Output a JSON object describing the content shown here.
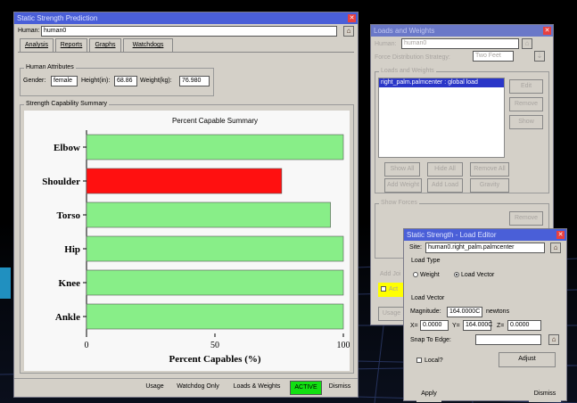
{
  "main": {
    "title": "Static Strength Prediction",
    "human_label": "Human:",
    "human_value": "human0",
    "tabs": [
      "Analysis",
      "Reports",
      "Graphs",
      "Watchdogs"
    ],
    "attributes": {
      "title": "Human Attributes",
      "gender_label": "Gender:",
      "gender_value": "female",
      "height_label": "Height(in):",
      "height_value": "68.86",
      "weight_label": "Weight(kg):",
      "weight_value": "76.980"
    },
    "summary_title": "Strength Capability Summary",
    "bottom_buttons": [
      "Usage",
      "Watchdog Only",
      "Loads & Weights",
      "ACTIVE",
      "Dismiss"
    ]
  },
  "chart_data": {
    "type": "bar",
    "orientation": "horizontal",
    "title": "Percent Capable Summary",
    "xlabel": "Percent Capables (%)",
    "xlim": [
      0,
      100
    ],
    "xticks": [
      "0",
      "50",
      "100"
    ],
    "categories": [
      "Elbow",
      "Shoulder",
      "Torso",
      "Hip",
      "Knee",
      "Ankle"
    ],
    "values": [
      100,
      76,
      95,
      100,
      100,
      100
    ],
    "colors": [
      "#88ee88",
      "#ff1010",
      "#88ee88",
      "#88ee88",
      "#88ee88",
      "#88ee88"
    ]
  },
  "loads": {
    "title": "Loads and Weights",
    "human_label": "Human:",
    "human_value": "human0",
    "strategy_label": "Force Distribution Strategy:",
    "strategy_value": "Two Feet",
    "group_title": "Loads and Weights",
    "list_item": "right_palm.palmcenter : global load",
    "side_buttons": [
      "Edit",
      "Remove",
      "Show"
    ],
    "row1": [
      "Show All",
      "Hide All",
      "Remove All"
    ],
    "row2": [
      "Add Weight",
      "Add Load",
      "Gravity"
    ],
    "forces_title": "Show Forces",
    "forces_remove": "Remove",
    "add_joint": "Add Joi",
    "active_label": "Act",
    "usage": "Usage"
  },
  "editor": {
    "title": "Static Strength - Load Editor",
    "site_label": "Site:",
    "site_value": "human0.right_palm.palmcenter",
    "load_type_title": "Load Type",
    "weight_opt": "Weight",
    "vector_opt": "Load Vector",
    "vector_title": "Load Vector",
    "magnitude_label": "Magnitude:",
    "magnitude_value": "164.0000C",
    "magnitude_unit": "newtons",
    "x_label": "X=",
    "x_value": "0.0000",
    "y_label": "Y=",
    "y_value": "164.000C",
    "z_label": "Z=",
    "z_value": "0.0000",
    "snap_label": "Snap To Edge:",
    "local_label": "Local?",
    "adjust": "Adjust",
    "apply": "Apply",
    "dismiss": "Dismiss"
  }
}
